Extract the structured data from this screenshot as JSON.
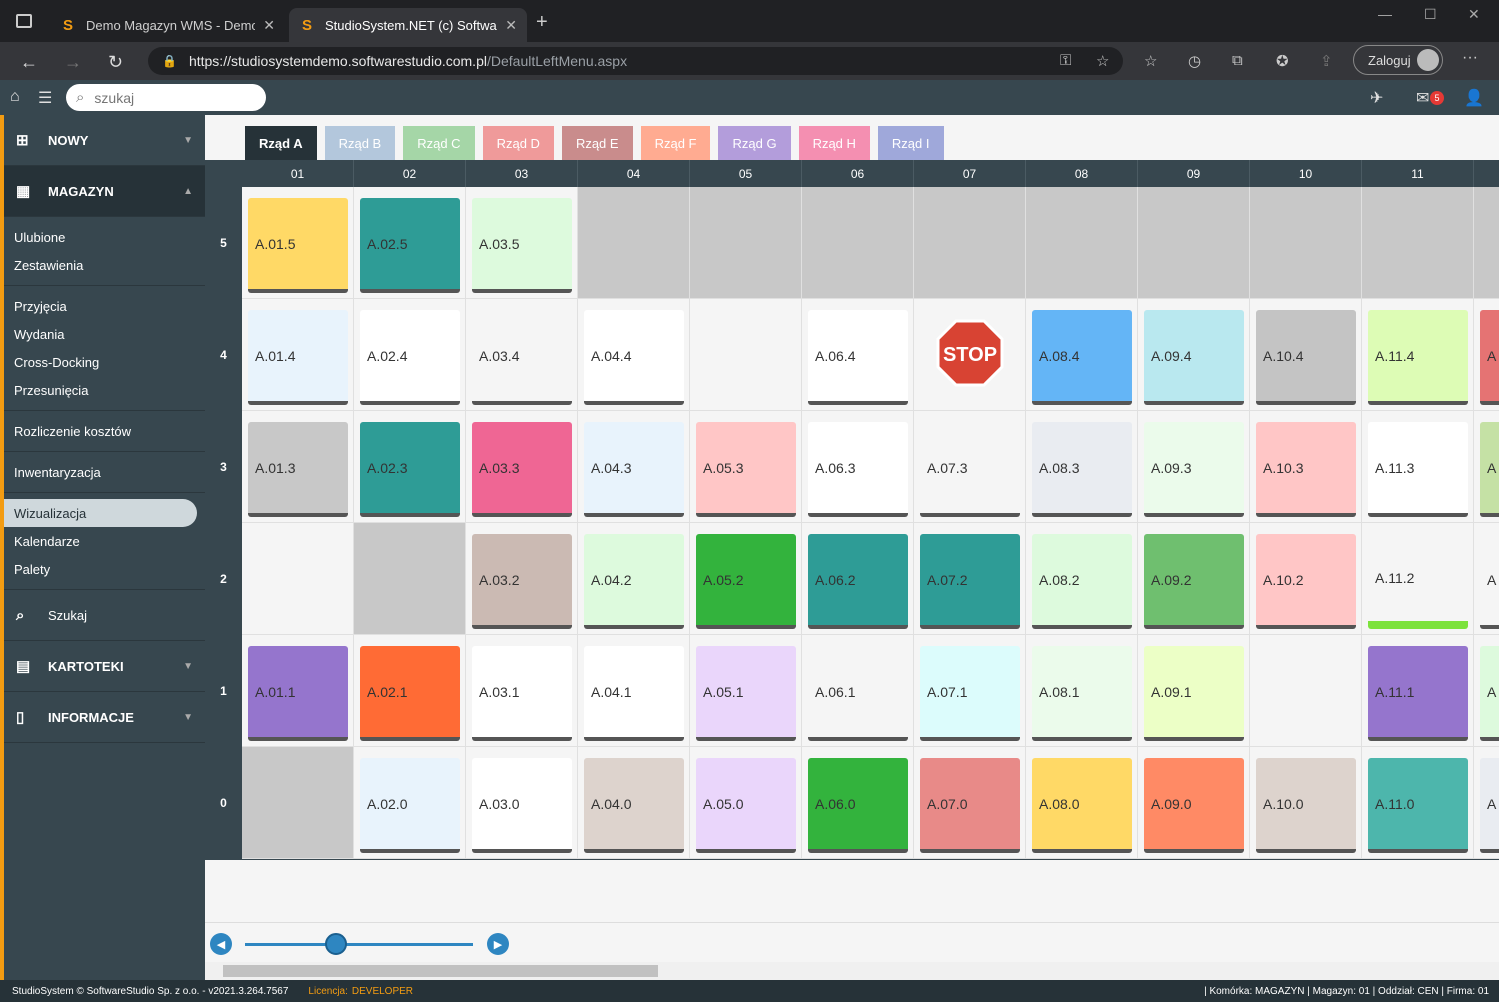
{
  "browser": {
    "tabs": [
      {
        "title": "Demo Magazyn WMS - Demo o"
      },
      {
        "title": "StudioSystem.NET (c) SoftwareSt"
      }
    ],
    "url_host": "https://studiosystemdemo.softwarestudio.com.pl",
    "url_path": "/DefaultLeftMenu.aspx",
    "login_label": "Zaloguj"
  },
  "appbar": {
    "search_placeholder": "szukaj",
    "mail_count": "5"
  },
  "sidebar": {
    "nowy": "NOWY",
    "magazyn": "MAGAZYN",
    "groups": [
      [
        "Ulubione",
        "Zestawienia"
      ],
      [
        "Przyjęcia",
        "Wydania",
        "Cross-Docking",
        "Przesunięcia"
      ],
      [
        "Rozliczenie kosztów"
      ],
      [
        "Inwentaryzacja"
      ],
      [
        "Wizualizacja",
        "Kalendarze",
        "Palety"
      ]
    ],
    "selected": "Wizualizacja",
    "szukaj": "Szukaj",
    "kartoteki": "KARTOTEKI",
    "informacje": "INFORMACJE"
  },
  "row_tabs": [
    {
      "label": "Rząd A",
      "color": "#263238"
    },
    {
      "label": "Rząd B",
      "color": "#b3c7dc"
    },
    {
      "label": "Rząd C",
      "color": "#a5d6a7"
    },
    {
      "label": "Rząd D",
      "color": "#ef9a9a"
    },
    {
      "label": "Rząd E",
      "color": "#c98c8c"
    },
    {
      "label": "Rząd F",
      "color": "#ffab91"
    },
    {
      "label": "Rząd G",
      "color": "#b39ddb"
    },
    {
      "label": "Rząd H",
      "color": "#f48fb1"
    },
    {
      "label": "Rząd I",
      "color": "#9fa8da"
    }
  ],
  "grid": {
    "columns": [
      "01",
      "02",
      "03",
      "04",
      "05",
      "06",
      "07",
      "08",
      "09",
      "10",
      "11"
    ],
    "shelves": [
      "5",
      "4",
      "3",
      "2",
      "1",
      "0"
    ],
    "cells": [
      [
        [
          "A.01.5",
          "#ffd966"
        ],
        [
          "A.02.5",
          "#2e9c96"
        ],
        [
          "A.03.5",
          "#ddfadd"
        ],
        [
          null,
          "empty"
        ],
        [
          null,
          "empty"
        ],
        [
          null,
          "empty"
        ],
        [
          null,
          "empty"
        ],
        [
          null,
          "empty"
        ],
        [
          null,
          "empty"
        ],
        [
          null,
          "empty"
        ],
        [
          null,
          "empty"
        ],
        [
          null,
          "empty"
        ]
      ],
      [
        [
          "A.01.4",
          "#e8f3fc"
        ],
        [
          "A.02.4",
          "#ffffff"
        ],
        [
          "A.03.4",
          "#f5f5f5"
        ],
        [
          "A.04.4",
          "#ffffff"
        ],
        [
          null,
          null
        ],
        [
          "A.06.4",
          "#ffffff"
        ],
        [
          "STOP",
          "stop"
        ],
        [
          "A.08.4",
          "#64b5f6"
        ],
        [
          "A.09.4",
          "#b9e8ef"
        ],
        [
          "A.10.4",
          "#c4c4c4"
        ],
        [
          "A.11.4",
          "#ddfcb5"
        ],
        [
          "A",
          "#e57373"
        ]
      ],
      [
        [
          "A.01.3",
          "#c8c8c8"
        ],
        [
          "A.02.3",
          "#2e9c96"
        ],
        [
          "A.03.3",
          "#ef6694"
        ],
        [
          "A.04.3",
          "#e8f3fc"
        ],
        [
          "A.05.3",
          "#ffc6c6"
        ],
        [
          "A.06.3",
          "#ffffff"
        ],
        [
          "A.07.3",
          "#f5f5f5"
        ],
        [
          "A.08.3",
          "#e9ecf1"
        ],
        [
          "A.09.3",
          "#ebfbeb"
        ],
        [
          "A.10.3",
          "#ffc6c6"
        ],
        [
          "A.11.3",
          "#ffffff"
        ],
        [
          "A",
          "#c5e1a5"
        ]
      ],
      [
        [
          null,
          null
        ],
        [
          null,
          "empty"
        ],
        [
          "A.03.2",
          "#cbbab3"
        ],
        [
          "A.04.2",
          "#ddfadd"
        ],
        [
          "A.05.2",
          "#33b33d"
        ],
        [
          "A.06.2",
          "#2e9c96"
        ],
        [
          "A.07.2",
          "#2e9c96"
        ],
        [
          "A.08.2",
          "#ddfadd"
        ],
        [
          "A.09.2",
          "#6fbf6f"
        ],
        [
          "A.10.2",
          "#ffc6c6"
        ],
        [
          "A.11.2",
          "#f5f5f5"
        ],
        [
          "A",
          "#f5f5f5"
        ]
      ],
      [
        [
          "A.01.1",
          "#9575cd"
        ],
        [
          "A.02.1",
          "#ff6b35"
        ],
        [
          "A.03.1",
          "#ffffff"
        ],
        [
          "A.04.1",
          "#ffffff"
        ],
        [
          "A.05.1",
          "#ead6fb"
        ],
        [
          "A.06.1",
          "#f5f5f5"
        ],
        [
          "A.07.1",
          "#dcfcfc"
        ],
        [
          "A.08.1",
          "#ebfbeb"
        ],
        [
          "A.09.1",
          "#ecffc6"
        ],
        [
          null,
          null
        ],
        [
          "A.11.1",
          "#9575cd"
        ],
        [
          "A",
          "#ddfadd"
        ]
      ],
      [
        [
          null,
          "empty"
        ],
        [
          "A.02.0",
          "#e8f3fc"
        ],
        [
          "A.03.0",
          "#ffffff"
        ],
        [
          "A.04.0",
          "#ddd3cd"
        ],
        [
          "A.05.0",
          "#ead6fb"
        ],
        [
          "A.06.0",
          "#33b33d"
        ],
        [
          "A.07.0",
          "#e88a88"
        ],
        [
          "A.08.0",
          "#ffd966"
        ],
        [
          "A.09.0",
          "#ff8a65"
        ],
        [
          "A.10.0",
          "#ddd3cd"
        ],
        [
          "A.11.0",
          "#4db6ac"
        ],
        [
          "A",
          "#e9ecf1"
        ]
      ]
    ]
  },
  "slider": {
    "position": 0.4
  },
  "footer": {
    "copyright": "StudioSystem © SoftwareStudio Sp. z o.o. - v2021.3.264.7567",
    "license_label": "Licencja:",
    "license_value": "DEVELOPER",
    "status": "| Komórka: MAGAZYN | Magazyn: 01 | Oddział: CEN | Firma: 01"
  }
}
